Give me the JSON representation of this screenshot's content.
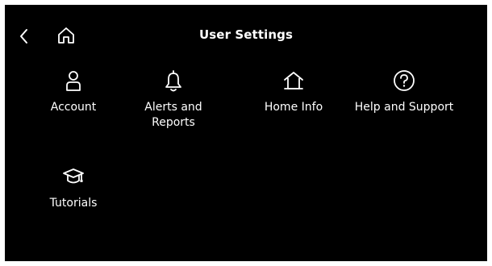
{
  "header": {
    "title": "User Settings",
    "back_icon": "chevron-left-icon",
    "home_icon": "home-icon"
  },
  "settings_items": [
    {
      "label": "Account",
      "icon": "person-icon"
    },
    {
      "label": "Alerts and Reports",
      "icon": "bell-icon"
    },
    {
      "label": "Home Info",
      "icon": "house-icon"
    },
    {
      "label": "Help and Support",
      "icon": "question-circle-icon"
    },
    {
      "label": "Tutorials",
      "icon": "graduation-cap-icon"
    }
  ],
  "colors": {
    "background": "#000000",
    "text": "#ffffff"
  }
}
